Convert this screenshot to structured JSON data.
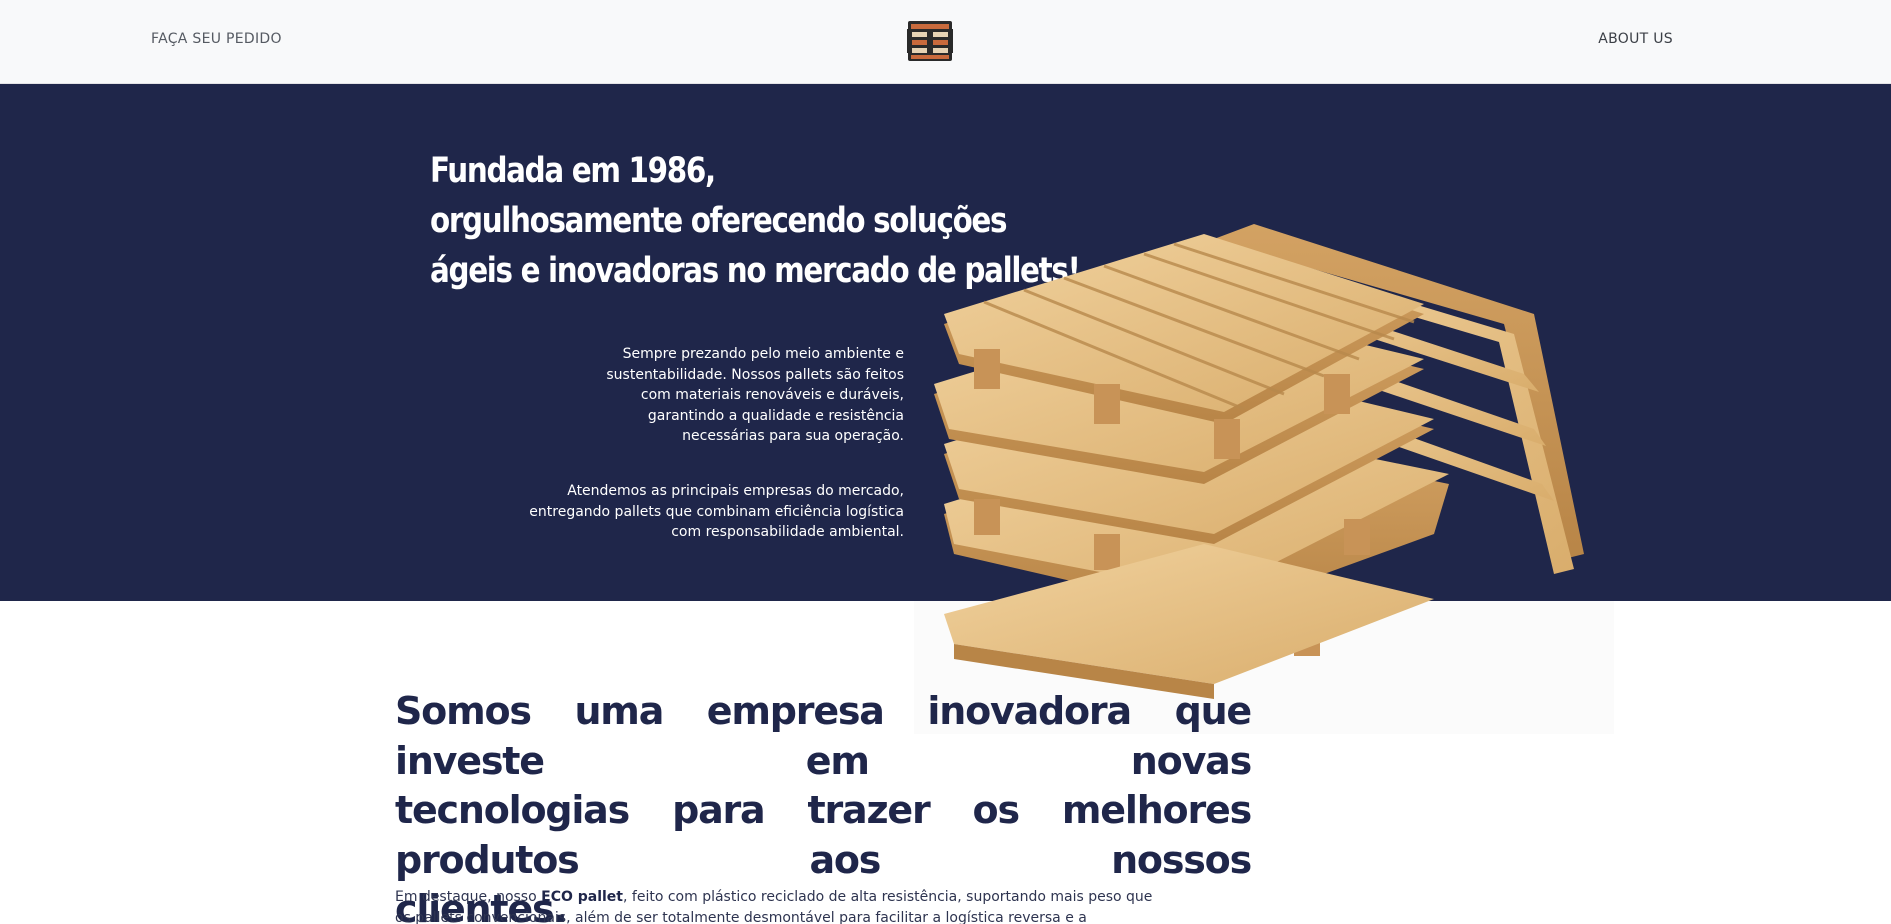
{
  "nav": {
    "order_link": "FAÇA SEU PEDIDO",
    "about_link": "ABOUT US",
    "logo_icon": "pallet-logo-icon"
  },
  "hero": {
    "title_lines": [
      "Fundada em 1986,",
      "orgulhosamente oferecendo soluções",
      "ágeis e inovadoras no mercado de pallets!"
    ],
    "paragraph_1": "Sempre prezando pelo meio ambiente e sustentabilidade. Nossos pallets são feitos com materiais renováveis e duráveis, garantindo a qualidade e resistência necessárias para sua operação.",
    "paragraph_2": "Atendemos as principais empresas do mercado, entregando pallets que combinam eficiência logística com responsabilidade ambiental.",
    "image_icon": "wooden-pallets-image"
  },
  "about": {
    "heading_lines": [
      "Somos uma empresa inovadora que investe em novas",
      "tecnologias para trazer os melhores produtos aos nossos",
      "clientes."
    ],
    "text_before": "Em destaque, nosso ",
    "text_bold": "ECO pallet",
    "text_after": ", feito com plástico reciclado de alta resistência, suportando mais peso que os pallets convencionais, além de ser totalmente desmontável para facilitar a logística reversa e a reciclagem do material."
  },
  "colors": {
    "navy": "#1f264a",
    "navbar_bg": "#f8f9fa",
    "wood": "#e8c48c",
    "logo_brown": "#8b4a2b"
  }
}
